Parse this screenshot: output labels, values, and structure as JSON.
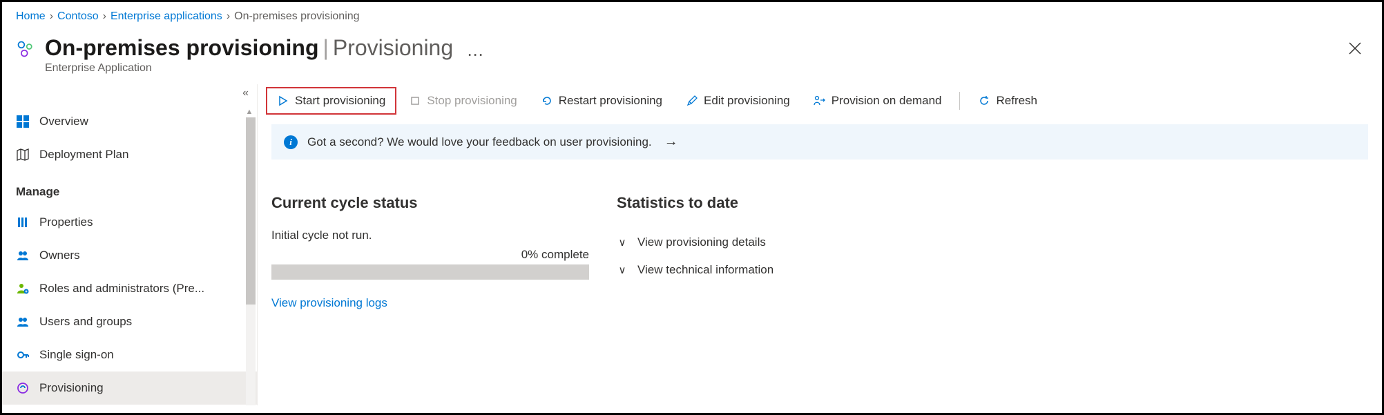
{
  "breadcrumb": {
    "items": [
      "Home",
      "Contoso",
      "Enterprise applications",
      "On-premises provisioning"
    ]
  },
  "header": {
    "title": "On-premises provisioning",
    "section": "Provisioning",
    "subtitle": "Enterprise Application"
  },
  "sidebar": {
    "overview": "Overview",
    "deployment_plan": "Deployment Plan",
    "manage_header": "Manage",
    "properties": "Properties",
    "owners": "Owners",
    "roles": "Roles and administrators (Pre...",
    "users_groups": "Users and groups",
    "single_signon": "Single sign-on",
    "provisioning": "Provisioning"
  },
  "toolbar": {
    "start": "Start provisioning",
    "stop": "Stop provisioning",
    "restart": "Restart provisioning",
    "edit": "Edit provisioning",
    "on_demand": "Provision on demand",
    "refresh": "Refresh"
  },
  "banner": {
    "text": "Got a second? We would love your feedback on user provisioning."
  },
  "status": {
    "heading": "Current cycle status",
    "text": "Initial cycle not run.",
    "progress_label": "0% complete",
    "logs_link": "View provisioning logs"
  },
  "stats": {
    "heading": "Statistics to date",
    "details": "View provisioning details",
    "technical": "View technical information"
  }
}
